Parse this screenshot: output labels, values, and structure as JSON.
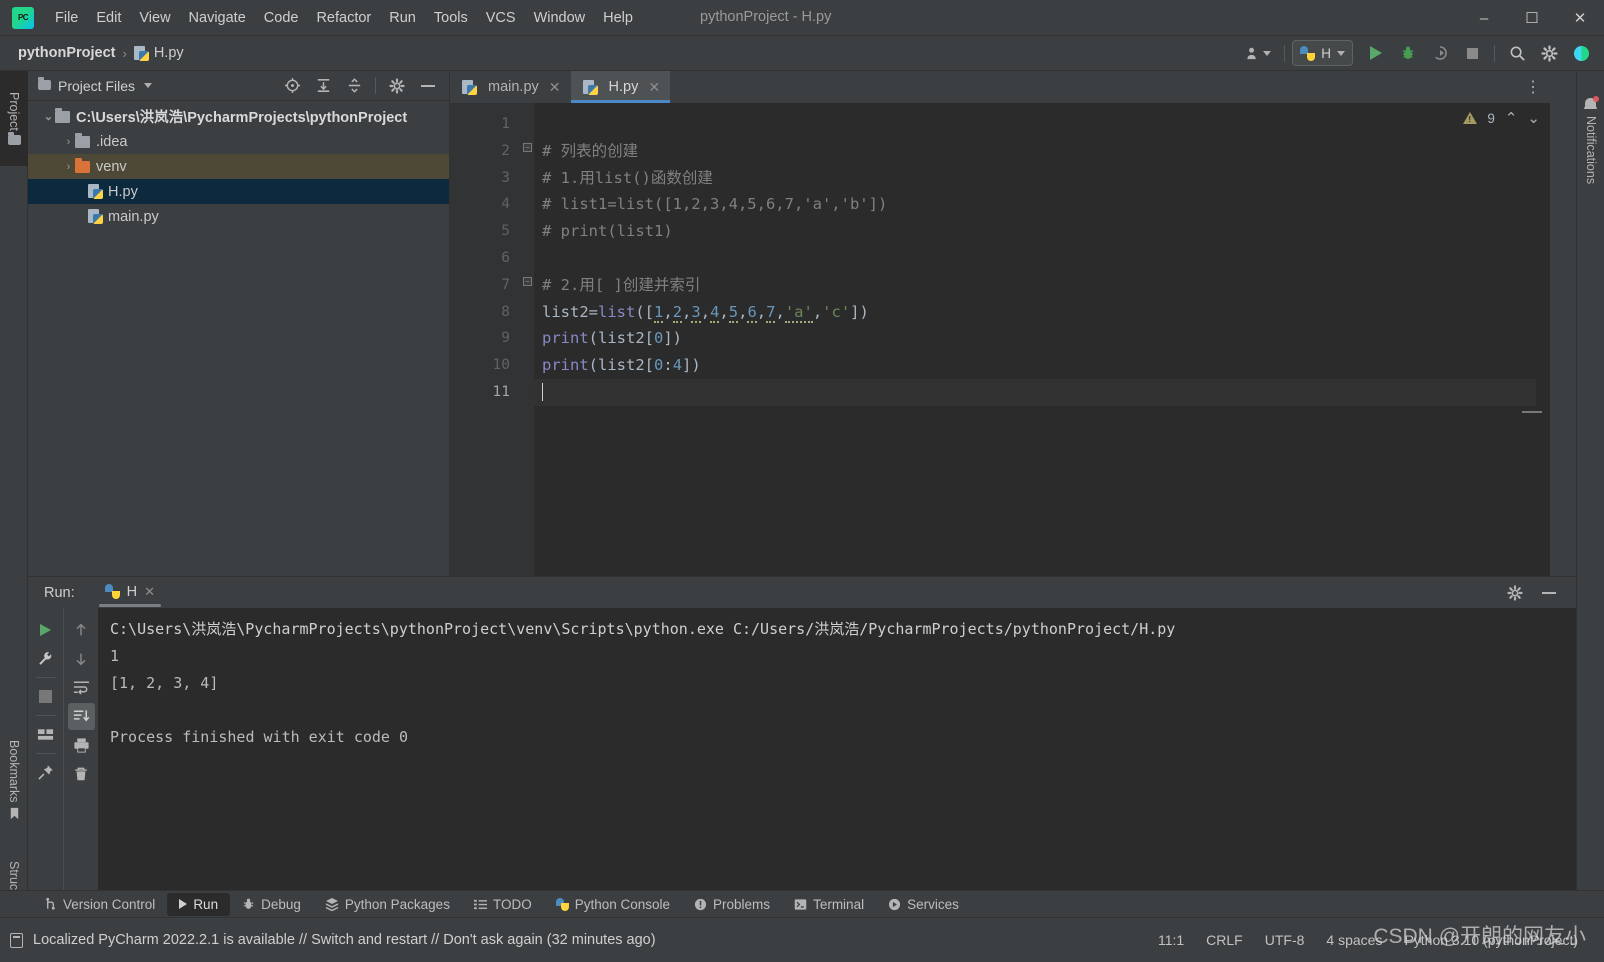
{
  "window": {
    "title": "pythonProject - H.py",
    "minimize": "–",
    "maximize": "☐",
    "close": "✕"
  },
  "menu": {
    "items": [
      "File",
      "Edit",
      "View",
      "Navigate",
      "Code",
      "Refactor",
      "Run",
      "Tools",
      "VCS",
      "Window",
      "Help"
    ]
  },
  "breadcrumb": {
    "project": "pythonProject",
    "separator": "›",
    "file": "H.py"
  },
  "toolbar": {
    "run_config": "H",
    "icons": [
      "user-dropdown",
      "run",
      "debug",
      "run-coverage",
      "stop",
      "search-everywhere",
      "settings",
      "ide-assistant"
    ]
  },
  "left_strip": {
    "tabs": [
      "Project",
      "Bookmarks",
      "Structure"
    ]
  },
  "right_strip": {
    "tabs": [
      "Notifications"
    ]
  },
  "project_panel": {
    "title": "Project Files",
    "header_icons": [
      "select-opened-file",
      "expand-all",
      "collapse-all",
      "settings",
      "hide"
    ],
    "tree": [
      {
        "label": "C:\\Users\\洪岚浩\\PycharmProjects\\pythonProject",
        "indent": 0,
        "chevron": "⌄",
        "type": "folder",
        "state": "root"
      },
      {
        "label": ".idea",
        "indent": 1,
        "chevron": "›",
        "type": "folder",
        "state": "normal"
      },
      {
        "label": "venv",
        "indent": 1,
        "chevron": "›",
        "type": "folder-orange",
        "state": "highlighted"
      },
      {
        "label": "H.py",
        "indent": 2,
        "chevron": "",
        "type": "python",
        "state": "selected"
      },
      {
        "label": "main.py",
        "indent": 2,
        "chevron": "",
        "type": "python",
        "state": "normal"
      }
    ]
  },
  "editor": {
    "tabs": [
      {
        "label": "main.py",
        "active": false,
        "close": "✕"
      },
      {
        "label": "H.py",
        "active": true,
        "close": "✕"
      }
    ],
    "warning_count": "9",
    "lines": [
      "1",
      "2",
      "3",
      "4",
      "5",
      "6",
      "7",
      "8",
      "9",
      "10",
      "11"
    ],
    "current_line": 11,
    "code": [
      {
        "n": 1,
        "segments": []
      },
      {
        "n": 2,
        "segments": [
          {
            "t": "# 列表的创建",
            "c": "cmt"
          }
        ]
      },
      {
        "n": 3,
        "segments": [
          {
            "t": "# 1.用list()函数创建",
            "c": "cmt"
          }
        ]
      },
      {
        "n": 4,
        "segments": [
          {
            "t": "# list1=list([1,2,3,4,5,6,7,'a','b'])",
            "c": "cmt"
          }
        ]
      },
      {
        "n": 5,
        "segments": [
          {
            "t": "# print(list1)",
            "c": "cmt"
          }
        ]
      },
      {
        "n": 6,
        "segments": []
      },
      {
        "n": 7,
        "segments": [
          {
            "t": "# 2.用[ ]创建并索引",
            "c": "cmt"
          }
        ]
      },
      {
        "n": 8,
        "segments": [
          {
            "t": "list2",
            "c": "plain"
          },
          {
            "t": "=",
            "c": "plain"
          },
          {
            "t": "list",
            "c": "pfn"
          },
          {
            "t": "([",
            "c": "plain"
          },
          {
            "t": "1",
            "c": "num"
          },
          {
            "t": ",",
            "c": "plain"
          },
          {
            "t": "2",
            "c": "num"
          },
          {
            "t": ",",
            "c": "plain"
          },
          {
            "t": "3",
            "c": "num"
          },
          {
            "t": ",",
            "c": "plain"
          },
          {
            "t": "4",
            "c": "num"
          },
          {
            "t": ",",
            "c": "plain"
          },
          {
            "t": "5",
            "c": "num"
          },
          {
            "t": ",",
            "c": "plain"
          },
          {
            "t": "6",
            "c": "num"
          },
          {
            "t": ",",
            "c": "plain"
          },
          {
            "t": "7",
            "c": "num"
          },
          {
            "t": ",",
            "c": "plain"
          },
          {
            "t": "'a'",
            "c": "str"
          },
          {
            "t": ",",
            "c": "plain"
          },
          {
            "t": "'c'",
            "c": "str"
          },
          {
            "t": "])",
            "c": "plain"
          }
        ]
      },
      {
        "n": 9,
        "segments": [
          {
            "t": "print",
            "c": "pfn"
          },
          {
            "t": "(list2[",
            "c": "plain"
          },
          {
            "t": "0",
            "c": "num"
          },
          {
            "t": "])",
            "c": "plain"
          }
        ]
      },
      {
        "n": 10,
        "segments": [
          {
            "t": "print",
            "c": "pfn"
          },
          {
            "t": "(list2[",
            "c": "plain"
          },
          {
            "t": "0",
            "c": "num"
          },
          {
            "t": ":",
            "c": "plain"
          },
          {
            "t": "4",
            "c": "num"
          },
          {
            "t": "])",
            "c": "plain"
          }
        ]
      },
      {
        "n": 11,
        "segments": []
      }
    ]
  },
  "run_panel": {
    "label": "Run:",
    "tab": "H",
    "tab_close": "✕",
    "toolbar_left": [
      "rerun",
      "modify-run-configuration",
      "stop",
      "restore-layout",
      "pin-tab"
    ],
    "toolbar_right": [
      "up-stack-trace",
      "down-stack-trace",
      "soft-wrap",
      "scroll-to-end",
      "print",
      "clear-all"
    ],
    "header_right": [
      "settings",
      "hide"
    ],
    "console": [
      {
        "text": "C:\\Users\\洪岚浩\\PycharmProjects\\pythonProject\\venv\\Scripts\\python.exe C:/Users/洪岚浩/PycharmProjects/pythonProject/H.py",
        "type": "path"
      },
      {
        "text": "1",
        "type": "out"
      },
      {
        "text": "[1, 2, 3, 4]",
        "type": "out"
      },
      {
        "text": "",
        "type": "out"
      },
      {
        "text": "Process finished with exit code 0",
        "type": "out"
      }
    ]
  },
  "bottom_tabs": [
    {
      "label": "Version Control",
      "icon": "branch-icon",
      "active": false
    },
    {
      "label": "Run",
      "icon": "play-icon",
      "active": true
    },
    {
      "label": "Debug",
      "icon": "bug-icon",
      "active": false
    },
    {
      "label": "Python Packages",
      "icon": "packages-icon",
      "active": false
    },
    {
      "label": "TODO",
      "icon": "list-icon",
      "active": false
    },
    {
      "label": "Python Console",
      "icon": "python-icon",
      "active": false
    },
    {
      "label": "Problems",
      "icon": "warning-circle-icon",
      "active": false
    },
    {
      "label": "Terminal",
      "icon": "terminal-icon",
      "active": false
    },
    {
      "label": "Services",
      "icon": "services-icon",
      "active": false
    }
  ],
  "status_bar": {
    "message": "Localized PyCharm 2022.2.1 is available // Switch and restart // Don't ask again (32 minutes ago)",
    "caret": "11:1",
    "line_sep": "CRLF",
    "encoding": "UTF-8",
    "indent": "4 spaces",
    "interpreter": "Python 3.10 (pythonProject)"
  },
  "watermark": "CSDN @开朗的网友小",
  "colors": {
    "accent": "#4a88c7",
    "bg": "#3c3f41",
    "editor_bg": "#2b2b2b",
    "selected": "#0d293e",
    "highlight": "#4e4937",
    "run_green": "#59a869",
    "warning": "#a39a60",
    "comment": "#808080",
    "number": "#6897bb",
    "string": "#6a8759"
  }
}
